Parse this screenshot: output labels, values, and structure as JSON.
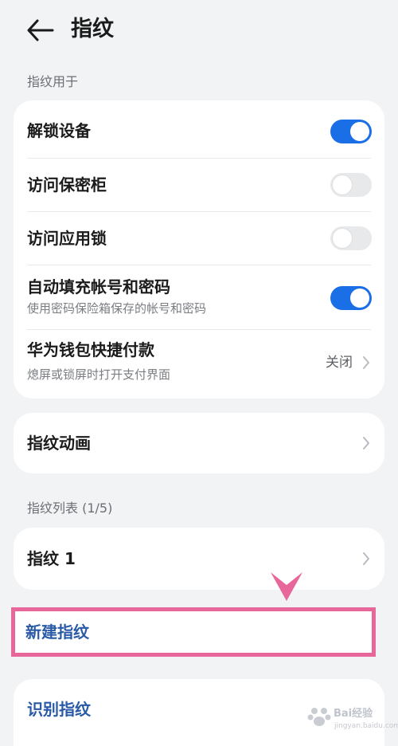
{
  "header": {
    "title": "指纹"
  },
  "fingerprint_use": {
    "section_label": "指纹用于",
    "items": [
      {
        "label": "解锁设备",
        "toggle": "on"
      },
      {
        "label": "访问保密柜",
        "toggle": "off"
      },
      {
        "label": "访问应用锁",
        "toggle": "off"
      },
      {
        "label": "自动填充帐号和密码",
        "subtitle": "使用密码保险箱保存的帐号和密码",
        "toggle": "on"
      },
      {
        "label": "华为钱包快捷付款",
        "subtitle": "熄屏或锁屏时打开支付界面",
        "value": "关闭"
      }
    ]
  },
  "animation": {
    "label": "指纹动画"
  },
  "fingerprint_list": {
    "section_label": "指纹列表 (1/5)",
    "items": [
      {
        "label": "指纹 1"
      }
    ]
  },
  "new_fingerprint": {
    "label": "新建指纹"
  },
  "identify_fingerprint": {
    "label": "识别指纹"
  },
  "watermark": {
    "text": "Bai经验",
    "sub": "jingyan.baidu.com"
  },
  "colors": {
    "accent": "#1a6ee6",
    "link": "#2a5aa6",
    "highlight": "#e8679a"
  }
}
